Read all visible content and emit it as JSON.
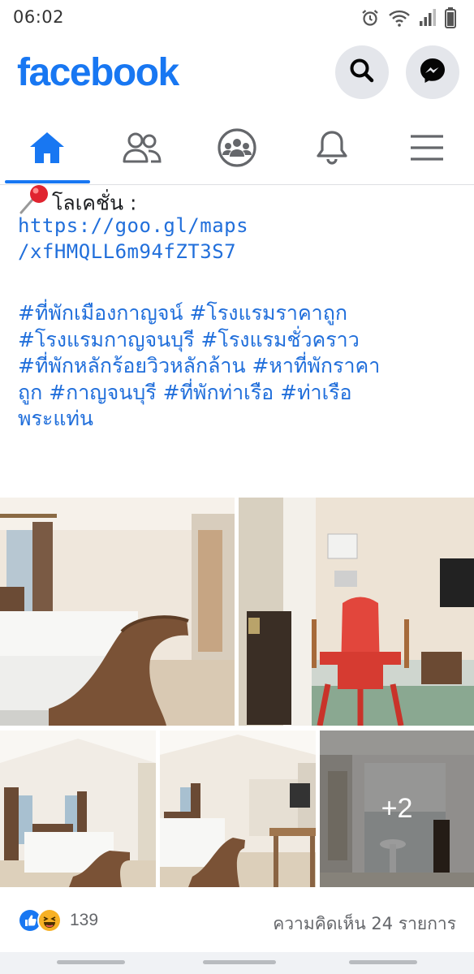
{
  "status_bar": {
    "time": "06:02",
    "icons": [
      "alarm-icon",
      "wifi-icon",
      "signal-icon",
      "battery-icon"
    ]
  },
  "header": {
    "logo": "facebook",
    "brand_color": "#1877f2",
    "buttons": [
      "search-icon",
      "messenger-icon"
    ]
  },
  "nav": {
    "tabs": [
      {
        "name": "home",
        "icon": "home-icon",
        "active": true
      },
      {
        "name": "friends",
        "icon": "friends-icon",
        "active": false
      },
      {
        "name": "groups",
        "icon": "groups-icon",
        "active": false
      },
      {
        "name": "notifications",
        "icon": "bell-icon",
        "active": false
      },
      {
        "name": "menu",
        "icon": "menu-icon",
        "active": false
      }
    ]
  },
  "post": {
    "location_label": "โลเคชั่น :",
    "link_line1": "https://goo.gl/maps",
    "link_line2": "/xfHMQLL6m94fZT3S7",
    "hashtag_lines": [
      "#ที่พักเมืองกาญจน์ #โรงแรมราคาถูก",
      "#โรงแรมกาญจนบุรี #โรงแรมชั่วคราว",
      "#ที่พักหลักร้อยวิวหลักล้าน #หาที่พักราคา",
      "ถูก #กาญจนบุรี #ที่พักท่าเรือ #ท่าเรือ",
      "พระแท่น"
    ],
    "photos": [
      "bedroom-chaise",
      "red-chair-room",
      "bedroom-wide",
      "bedroom-desk",
      "bathroom"
    ],
    "more_photos_label": "+2"
  },
  "reactions": {
    "icons": [
      "like-icon",
      "haha-icon"
    ],
    "count": "139",
    "comments": "ความคิดเห็น 24 รายการ"
  }
}
